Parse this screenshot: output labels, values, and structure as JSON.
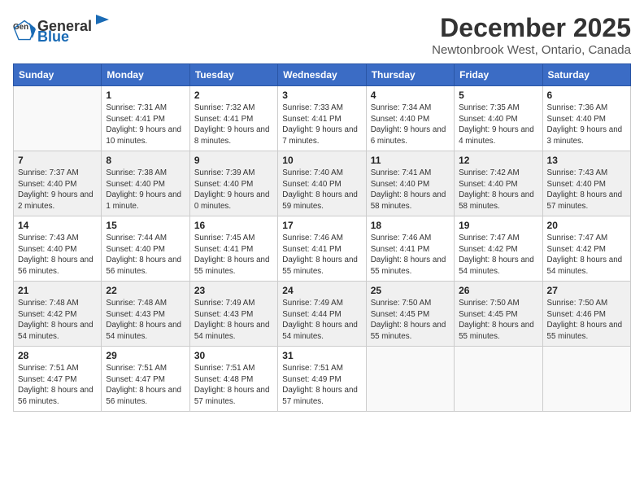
{
  "logo": {
    "general": "General",
    "blue": "Blue"
  },
  "title": "December 2025",
  "location": "Newtonbrook West, Ontario, Canada",
  "weekdays": [
    "Sunday",
    "Monday",
    "Tuesday",
    "Wednesday",
    "Thursday",
    "Friday",
    "Saturday"
  ],
  "weeks": [
    [
      {
        "day": "",
        "sunrise": "",
        "sunset": "",
        "daylight": "",
        "empty": true
      },
      {
        "day": "1",
        "sunrise": "Sunrise: 7:31 AM",
        "sunset": "Sunset: 4:41 PM",
        "daylight": "Daylight: 9 hours and 10 minutes.",
        "empty": false
      },
      {
        "day": "2",
        "sunrise": "Sunrise: 7:32 AM",
        "sunset": "Sunset: 4:41 PM",
        "daylight": "Daylight: 9 hours and 8 minutes.",
        "empty": false
      },
      {
        "day": "3",
        "sunrise": "Sunrise: 7:33 AM",
        "sunset": "Sunset: 4:41 PM",
        "daylight": "Daylight: 9 hours and 7 minutes.",
        "empty": false
      },
      {
        "day": "4",
        "sunrise": "Sunrise: 7:34 AM",
        "sunset": "Sunset: 4:40 PM",
        "daylight": "Daylight: 9 hours and 6 minutes.",
        "empty": false
      },
      {
        "day": "5",
        "sunrise": "Sunrise: 7:35 AM",
        "sunset": "Sunset: 4:40 PM",
        "daylight": "Daylight: 9 hours and 4 minutes.",
        "empty": false
      },
      {
        "day": "6",
        "sunrise": "Sunrise: 7:36 AM",
        "sunset": "Sunset: 4:40 PM",
        "daylight": "Daylight: 9 hours and 3 minutes.",
        "empty": false
      }
    ],
    [
      {
        "day": "7",
        "sunrise": "Sunrise: 7:37 AM",
        "sunset": "Sunset: 4:40 PM",
        "daylight": "Daylight: 9 hours and 2 minutes.",
        "empty": false
      },
      {
        "day": "8",
        "sunrise": "Sunrise: 7:38 AM",
        "sunset": "Sunset: 4:40 PM",
        "daylight": "Daylight: 9 hours and 1 minute.",
        "empty": false
      },
      {
        "day": "9",
        "sunrise": "Sunrise: 7:39 AM",
        "sunset": "Sunset: 4:40 PM",
        "daylight": "Daylight: 9 hours and 0 minutes.",
        "empty": false
      },
      {
        "day": "10",
        "sunrise": "Sunrise: 7:40 AM",
        "sunset": "Sunset: 4:40 PM",
        "daylight": "Daylight: 8 hours and 59 minutes.",
        "empty": false
      },
      {
        "day": "11",
        "sunrise": "Sunrise: 7:41 AM",
        "sunset": "Sunset: 4:40 PM",
        "daylight": "Daylight: 8 hours and 58 minutes.",
        "empty": false
      },
      {
        "day": "12",
        "sunrise": "Sunrise: 7:42 AM",
        "sunset": "Sunset: 4:40 PM",
        "daylight": "Daylight: 8 hours and 58 minutes.",
        "empty": false
      },
      {
        "day": "13",
        "sunrise": "Sunrise: 7:43 AM",
        "sunset": "Sunset: 4:40 PM",
        "daylight": "Daylight: 8 hours and 57 minutes.",
        "empty": false
      }
    ],
    [
      {
        "day": "14",
        "sunrise": "Sunrise: 7:43 AM",
        "sunset": "Sunset: 4:40 PM",
        "daylight": "Daylight: 8 hours and 56 minutes.",
        "empty": false
      },
      {
        "day": "15",
        "sunrise": "Sunrise: 7:44 AM",
        "sunset": "Sunset: 4:40 PM",
        "daylight": "Daylight: 8 hours and 56 minutes.",
        "empty": false
      },
      {
        "day": "16",
        "sunrise": "Sunrise: 7:45 AM",
        "sunset": "Sunset: 4:41 PM",
        "daylight": "Daylight: 8 hours and 55 minutes.",
        "empty": false
      },
      {
        "day": "17",
        "sunrise": "Sunrise: 7:46 AM",
        "sunset": "Sunset: 4:41 PM",
        "daylight": "Daylight: 8 hours and 55 minutes.",
        "empty": false
      },
      {
        "day": "18",
        "sunrise": "Sunrise: 7:46 AM",
        "sunset": "Sunset: 4:41 PM",
        "daylight": "Daylight: 8 hours and 55 minutes.",
        "empty": false
      },
      {
        "day": "19",
        "sunrise": "Sunrise: 7:47 AM",
        "sunset": "Sunset: 4:42 PM",
        "daylight": "Daylight: 8 hours and 54 minutes.",
        "empty": false
      },
      {
        "day": "20",
        "sunrise": "Sunrise: 7:47 AM",
        "sunset": "Sunset: 4:42 PM",
        "daylight": "Daylight: 8 hours and 54 minutes.",
        "empty": false
      }
    ],
    [
      {
        "day": "21",
        "sunrise": "Sunrise: 7:48 AM",
        "sunset": "Sunset: 4:42 PM",
        "daylight": "Daylight: 8 hours and 54 minutes.",
        "empty": false
      },
      {
        "day": "22",
        "sunrise": "Sunrise: 7:48 AM",
        "sunset": "Sunset: 4:43 PM",
        "daylight": "Daylight: 8 hours and 54 minutes.",
        "empty": false
      },
      {
        "day": "23",
        "sunrise": "Sunrise: 7:49 AM",
        "sunset": "Sunset: 4:43 PM",
        "daylight": "Daylight: 8 hours and 54 minutes.",
        "empty": false
      },
      {
        "day": "24",
        "sunrise": "Sunrise: 7:49 AM",
        "sunset": "Sunset: 4:44 PM",
        "daylight": "Daylight: 8 hours and 54 minutes.",
        "empty": false
      },
      {
        "day": "25",
        "sunrise": "Sunrise: 7:50 AM",
        "sunset": "Sunset: 4:45 PM",
        "daylight": "Daylight: 8 hours and 55 minutes.",
        "empty": false
      },
      {
        "day": "26",
        "sunrise": "Sunrise: 7:50 AM",
        "sunset": "Sunset: 4:45 PM",
        "daylight": "Daylight: 8 hours and 55 minutes.",
        "empty": false
      },
      {
        "day": "27",
        "sunrise": "Sunrise: 7:50 AM",
        "sunset": "Sunset: 4:46 PM",
        "daylight": "Daylight: 8 hours and 55 minutes.",
        "empty": false
      }
    ],
    [
      {
        "day": "28",
        "sunrise": "Sunrise: 7:51 AM",
        "sunset": "Sunset: 4:47 PM",
        "daylight": "Daylight: 8 hours and 56 minutes.",
        "empty": false
      },
      {
        "day": "29",
        "sunrise": "Sunrise: 7:51 AM",
        "sunset": "Sunset: 4:47 PM",
        "daylight": "Daylight: 8 hours and 56 minutes.",
        "empty": false
      },
      {
        "day": "30",
        "sunrise": "Sunrise: 7:51 AM",
        "sunset": "Sunset: 4:48 PM",
        "daylight": "Daylight: 8 hours and 57 minutes.",
        "empty": false
      },
      {
        "day": "31",
        "sunrise": "Sunrise: 7:51 AM",
        "sunset": "Sunset: 4:49 PM",
        "daylight": "Daylight: 8 hours and 57 minutes.",
        "empty": false
      },
      {
        "day": "",
        "sunrise": "",
        "sunset": "",
        "daylight": "",
        "empty": true
      },
      {
        "day": "",
        "sunrise": "",
        "sunset": "",
        "daylight": "",
        "empty": true
      },
      {
        "day": "",
        "sunrise": "",
        "sunset": "",
        "daylight": "",
        "empty": true
      }
    ]
  ]
}
